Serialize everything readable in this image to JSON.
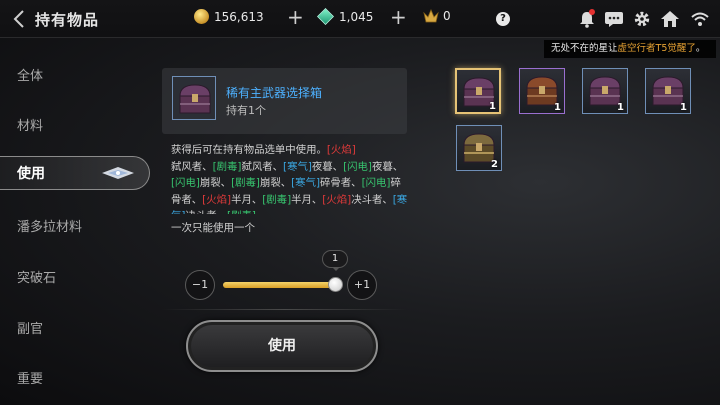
{
  "header": {
    "title": "持有物品",
    "gold": "156,613",
    "gems": "1,045",
    "crowns": "0",
    "help_label": "?"
  },
  "marquee": {
    "prefix": "无处不在的星让",
    "highlight": "虚空行者T5觉醒了",
    "suffix": "。"
  },
  "sidebar": {
    "items": [
      {
        "label": "全体"
      },
      {
        "label": "材料"
      },
      {
        "label": "使用"
      },
      {
        "label": "潘多拉材料"
      },
      {
        "label": "突破石"
      },
      {
        "label": "副官"
      },
      {
        "label": "重要"
      }
    ],
    "active_index": 2
  },
  "detail": {
    "name": "稀有主武器选择箱",
    "owned": "持有1个",
    "description": {
      "intro": "获得后可在持有物品选单中使用。",
      "tags": [
        {
          "t": "[火焰]",
          "c": "r"
        },
        {
          "t": "弑风者、",
          "c": ""
        },
        {
          "t": "[剧毒]",
          "c": "g"
        },
        {
          "t": "弑风者、",
          "c": ""
        },
        {
          "t": "[寒气]",
          "c": "b"
        },
        {
          "t": "夜暮、",
          "c": ""
        },
        {
          "t": "[闪电]",
          "c": "g"
        },
        {
          "t": "夜暮、",
          "c": ""
        },
        {
          "t": "[闪电]",
          "c": "g"
        },
        {
          "t": "崩裂、",
          "c": ""
        },
        {
          "t": "[剧毒]",
          "c": "g"
        },
        {
          "t": "崩裂、",
          "c": ""
        },
        {
          "t": "[寒气]",
          "c": "b"
        },
        {
          "t": "碎骨者、",
          "c": ""
        },
        {
          "t": "[闪电]",
          "c": "g"
        },
        {
          "t": "碎骨者、",
          "c": ""
        },
        {
          "t": "[火焰]",
          "c": "r"
        },
        {
          "t": "半月、",
          "c": ""
        },
        {
          "t": "[剧毒]",
          "c": "g"
        },
        {
          "t": "半月、",
          "c": ""
        },
        {
          "t": "[火焰]",
          "c": "r"
        },
        {
          "t": "决斗者、",
          "c": ""
        },
        {
          "t": "[寒气]",
          "c": "b"
        },
        {
          "t": "决斗者、",
          "c": ""
        },
        {
          "t": "[剧毒]",
          "c": "g"
        }
      ]
    },
    "once_note": "一次只能使用一个",
    "quantity": "1",
    "quantity_fraction": 1.0,
    "minus_label": "−1",
    "plus_label": "+1",
    "use_label": "使用"
  },
  "inventory": [
    {
      "count": "1",
      "kind": "chest-purple",
      "selected": true
    },
    {
      "count": "1",
      "kind": "chest-brown",
      "selected": false,
      "frame": "purple"
    },
    {
      "count": "1",
      "kind": "chest-purple",
      "selected": false
    },
    {
      "count": "1",
      "kind": "chest-purple",
      "selected": false
    },
    {
      "count": "2",
      "kind": "chest-gold",
      "selected": false
    }
  ],
  "colors": {
    "accent_gold": "#e6c376",
    "item_name_blue": "#4db1ff",
    "tag_red": "#e03a3a",
    "tag_green": "#37c36e",
    "tag_blue": "#3aa6e0"
  }
}
